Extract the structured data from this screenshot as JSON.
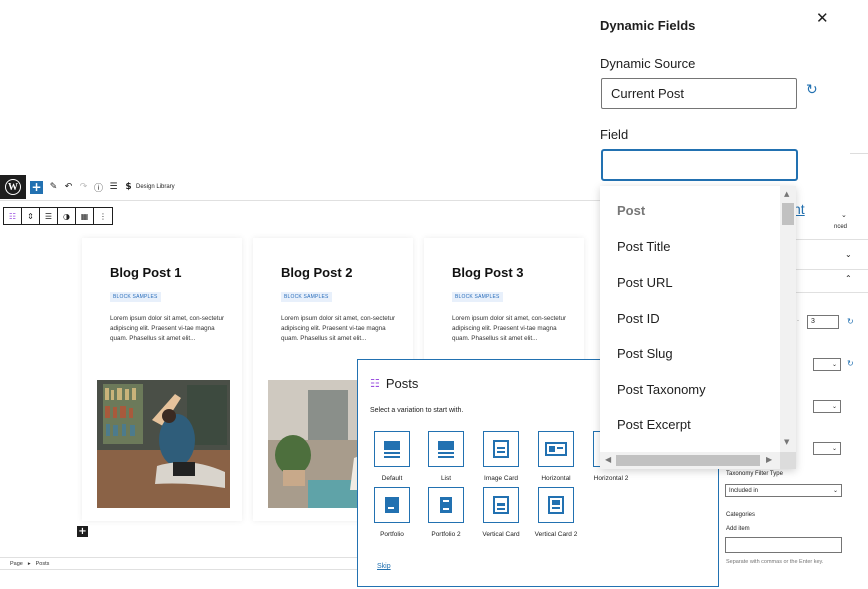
{
  "topbar": {
    "design_library": "Design Library"
  },
  "cards": [
    {
      "title": "Blog Post 1",
      "badge": "BLOCK SAMPLES",
      "excerpt": "Lorem ipsum dolor sit amet, con-sectetur adipiscing elit. Praesent vi-tae magna quam. Phasellus sit amet elit..."
    },
    {
      "title": "Blog Post 2",
      "badge": "BLOCK SAMPLES",
      "excerpt": "Lorem ipsum dolor sit amet, con-sectetur adipiscing elit. Praesent vi-tae magna quam. Phasellus sit amet elit..."
    },
    {
      "title": "Blog Post 3",
      "badge": "BLOCK SAMPLES",
      "excerpt": "Lorem ipsum dolor sit amet, con-sectetur adipiscing elit. Praesent vi-tae magna quam. Phasellus sit amet elit..."
    }
  ],
  "breadcrumb": {
    "page": "Page",
    "separator": "▸",
    "block": "Posts"
  },
  "dynamic_fields": {
    "title": "Dynamic Fields",
    "source_label": "Dynamic Source",
    "source_value": "Current Post",
    "field_label": "Field",
    "field_value": "",
    "options": [
      "Post",
      "Post Title",
      "Post URL",
      "Post ID",
      "Post Slug",
      "Post Taxonomy",
      "Post Excerpt"
    ]
  },
  "posts_picker": {
    "title": "Posts",
    "subtitle": "Select a variation to start with.",
    "variations": [
      "Default",
      "List",
      "Image Card",
      "Horizontal",
      "Horizontal 2",
      "Portfolio",
      "Portfolio 2",
      "Vertical Card",
      "Vertical Card 2"
    ],
    "skip": "Skip"
  },
  "sidebar": {
    "link_fragment": "nt",
    "advanced_fragment": "nced",
    "number_value": "3",
    "taxonomy_filter_label": "Taxonomy Filter Type",
    "taxonomy_filter_value": "Included in",
    "categories_label": "Categories",
    "add_item_label": "Add item",
    "help_text": "Separate with commas or the Enter key."
  },
  "colors": {
    "accent": "#2271b1",
    "brand_purple": "#9b51e0",
    "dark": "#1e1e1e"
  }
}
